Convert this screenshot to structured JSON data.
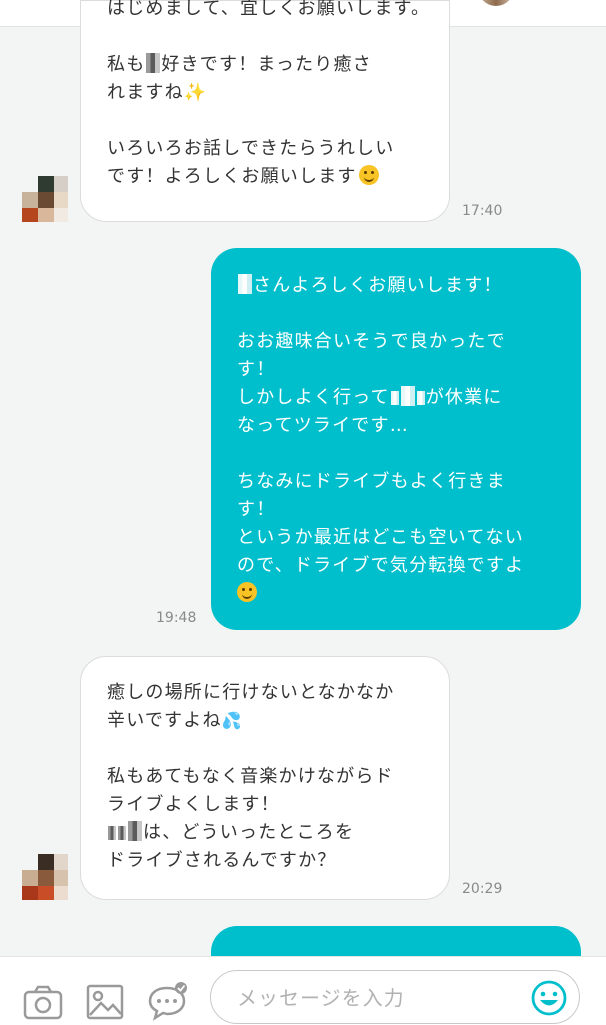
{
  "colors": {
    "outgoing_bubble": "#00bfcc",
    "incoming_bubble": "#ffffff",
    "background": "#f3f4f4",
    "emoji_accent": "#00bfcc"
  },
  "messages": [
    {
      "direction": "incoming",
      "time": "17:40",
      "p1": "はじめまして、宜しくお願いします。",
      "p2a_1": "私も",
      "p2a_2": "好きです！まったり癒さ",
      "p2b": "れますね",
      "p3a": "いろいろお話しできたらうれしい",
      "p3b": "です！よろしくお願いします"
    },
    {
      "direction": "outgoing",
      "time": "19:48",
      "p1": "さんよろしくお願いします！",
      "p2a": "おお趣味合いそうで良かったで",
      "p2b": "す！",
      "p2c_1": "しかしよく行って",
      "p2c_2": "が休業に",
      "p2d": "なってツライです…",
      "p3a": "ちなみにドライブもよく行きま",
      "p3b": "す！",
      "p3c": "というか最近はどこも空いてない",
      "p3d": "ので、ドライブで気分転換ですよ"
    },
    {
      "direction": "incoming",
      "time": "20:29",
      "p1a": "癒しの場所に行けないとなかなか",
      "p1b": "辛いですよね",
      "p2a": "私もあてもなく音楽かけながらド",
      "p2b": "ライブよくします！",
      "p2c": "は、どういったところを",
      "p2d": "ドライブされるんですか？"
    }
  ],
  "composer": {
    "placeholder": "メッセージを入力",
    "icons": [
      "camera-icon",
      "image-icon",
      "chat-bubble-icon",
      "emoji-icon"
    ]
  }
}
